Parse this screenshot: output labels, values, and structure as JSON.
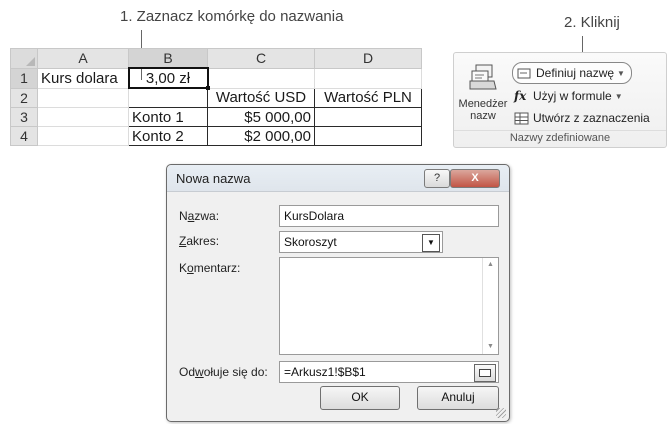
{
  "callouts": {
    "step1": "1. Zaznacz komórkę do nazwania",
    "step2": "2. Kliknij"
  },
  "sheet": {
    "columns": [
      "A",
      "B",
      "C",
      "D"
    ],
    "rows": [
      "1",
      "2",
      "3",
      "4"
    ],
    "cells": {
      "A1": "Kurs dolara",
      "B1": "3,00 zł",
      "C2": "Wartość USD",
      "D2": "Wartość PLN",
      "B3": "Konto 1",
      "C3": "$5 000,00",
      "B4": "Konto 2",
      "C4": "$2 000,00"
    },
    "selected_cell": "B1"
  },
  "ribbon": {
    "name_manager_label": "Menedżer\nnazw",
    "define_name": "Definiuj nazwę",
    "use_in_formula": "Użyj w formule",
    "create_from_selection": "Utwórz z zaznaczenia",
    "group_label": "Nazwy zdefiniowane",
    "icons": {
      "name_manager": "name-manager-icon",
      "define_name": "define-name-icon",
      "use_in_formula": "formula-icon",
      "create_from_selection": "grid-icon"
    }
  },
  "dialog": {
    "title": "Nowa nazwa",
    "help_button": "?",
    "close_button": "X",
    "name_label_prefix": "N",
    "name_label_ul": "a",
    "name_label_suffix": "zwa:",
    "name_value": "KursDolara",
    "scope_label_ul": "Z",
    "scope_label_suffix": "akres:",
    "scope_value": "Skoroszyt",
    "comment_label_prefix": "K",
    "comment_label_ul": "o",
    "comment_label_suffix": "mentarz:",
    "comment_value": "",
    "refers_label_prefix": "Od",
    "refers_label_ul": "w",
    "refers_label_suffix": "ołuje się do:",
    "refers_value": "=Arkusz1!$B$1",
    "ok_button": "OK",
    "cancel_button": "Anuluj"
  }
}
